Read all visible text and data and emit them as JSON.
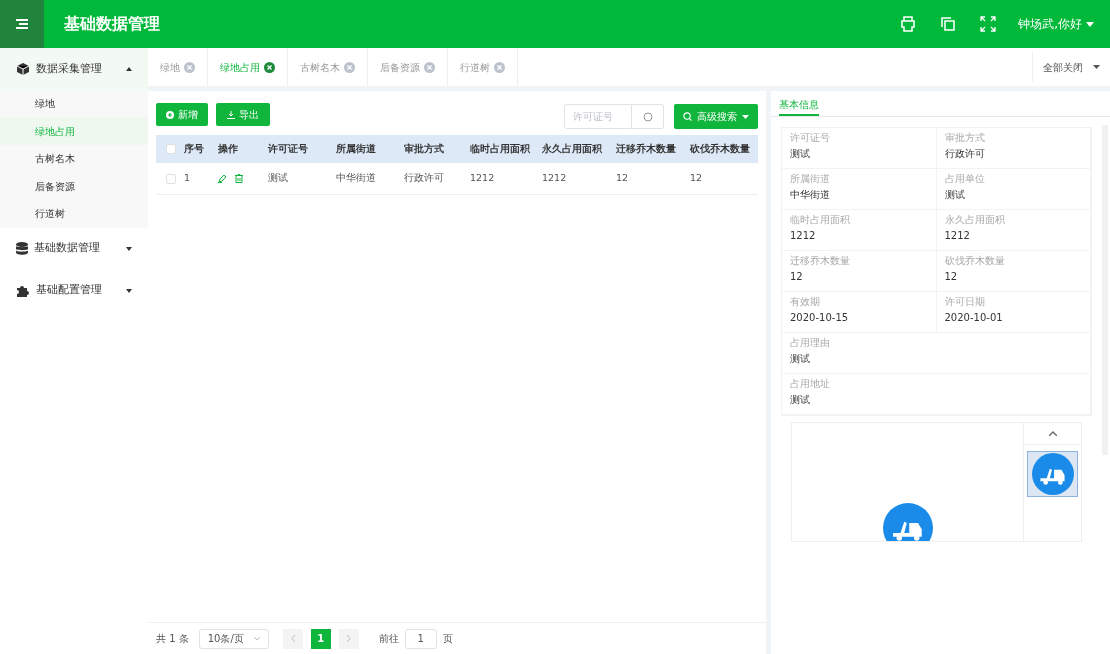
{
  "header": {
    "title": "基础数据管理",
    "user": "钟场武,你好"
  },
  "sidebar": [
    {
      "label": "数据采集管理",
      "expanded": true,
      "children": [
        {
          "label": "绿地",
          "selected": false
        },
        {
          "label": "绿地占用",
          "selected": true
        },
        {
          "label": "古树名木",
          "selected": false
        },
        {
          "label": "后备资源",
          "selected": false
        },
        {
          "label": "行道树",
          "selected": false
        }
      ]
    },
    {
      "label": "基础数据管理",
      "expanded": false
    },
    {
      "label": "基础配置管理",
      "expanded": false
    }
  ],
  "tabs": [
    {
      "label": "绿地",
      "selected": false
    },
    {
      "label": "绿地占用",
      "selected": true
    },
    {
      "label": "古树名木",
      "selected": false
    },
    {
      "label": "后备资源",
      "selected": false
    },
    {
      "label": "行道树",
      "selected": false
    }
  ],
  "close_all": "全部关闭",
  "toolbar": {
    "add": "新增",
    "export": "导出",
    "search_placeholder": "许可证号",
    "advanced_search": "高级搜索"
  },
  "table": {
    "select_all_checked": false,
    "columns": [
      "序号",
      "操作",
      "许可证号",
      "所属街道",
      "审批方式",
      "临时占用面积",
      "永久占用面积",
      "迁移乔木数量",
      "砍伐乔木数量"
    ],
    "rows": [
      {
        "checked": false,
        "cells": [
          "1",
          "",
          "测试",
          "中华街道",
          "行政许可",
          "1212",
          "1212",
          "12",
          "12"
        ]
      }
    ]
  },
  "pagination": {
    "total": "共 1 条",
    "page_size": "10条/页",
    "pages": [
      {
        "label": "1",
        "selected": true
      }
    ],
    "goto": "前往",
    "goto_value": "1",
    "unit": "页"
  },
  "detail": {
    "tab": "基本信息",
    "fields": [
      {
        "label": "许可证号",
        "value": "测试",
        "kind": "half"
      },
      {
        "label": "审批方式",
        "value": "行政许可",
        "kind": "half"
      },
      {
        "label": "所属街道",
        "value": "中华街道",
        "kind": "half"
      },
      {
        "label": "占用单位",
        "value": "测试",
        "kind": "half"
      },
      {
        "label": "临时占用面积",
        "value": "1212",
        "kind": "half"
      },
      {
        "label": "永久占用面积",
        "value": "1212",
        "kind": "half"
      },
      {
        "label": "迁移乔木数量",
        "value": "12",
        "kind": "half"
      },
      {
        "label": "砍伐乔木数量",
        "value": "12",
        "kind": "half"
      },
      {
        "label": "有效期",
        "value": "2020-10-15",
        "kind": "half"
      },
      {
        "label": "许可日期",
        "value": "2020-10-01",
        "kind": "half"
      },
      {
        "label": "占用理由",
        "value": "测试",
        "kind": "full"
      },
      {
        "label": "占用地址",
        "value": "测试",
        "kind": "full"
      }
    ],
    "thumbnails": [
      {
        "selected": true
      }
    ]
  }
}
